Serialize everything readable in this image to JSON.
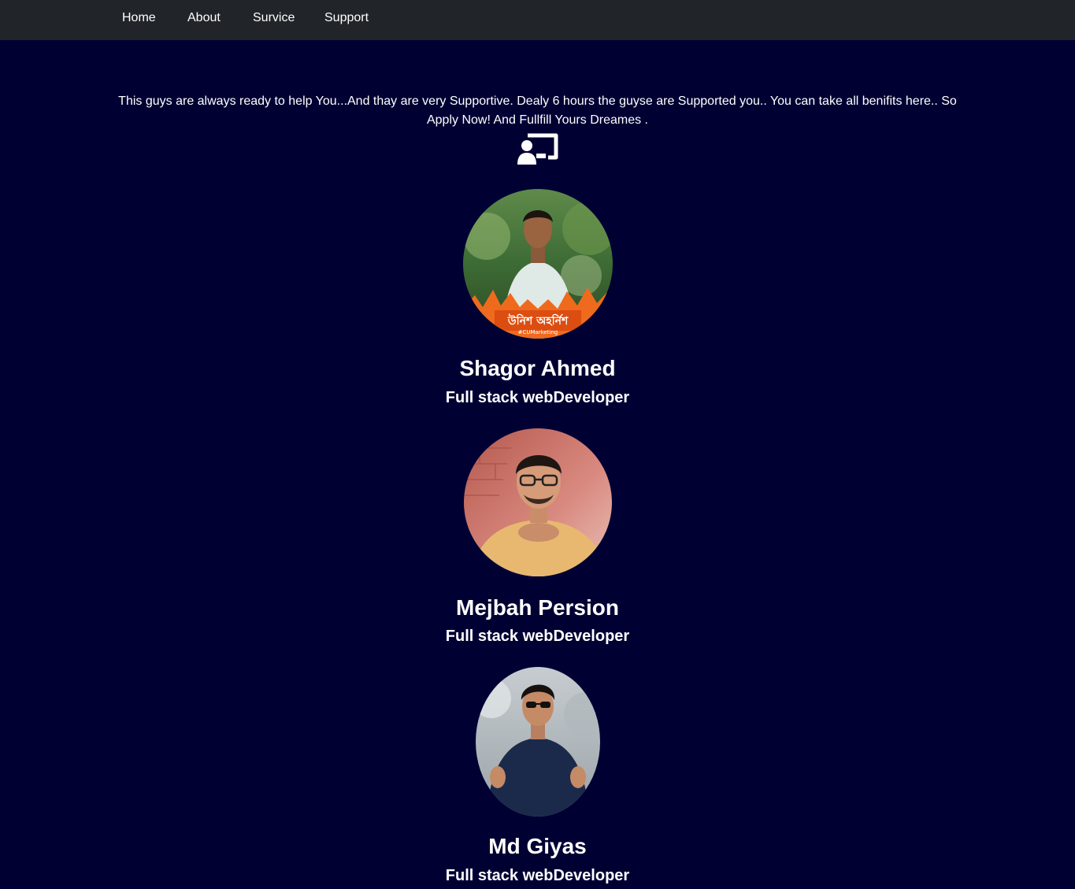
{
  "nav": {
    "items": [
      {
        "label": "Home"
      },
      {
        "label": "About"
      },
      {
        "label": "Survice"
      },
      {
        "label": "Support"
      }
    ]
  },
  "intro": {
    "text": "This guys are always ready to help You...And thay are very Supportive. Dealy 6 hours the guyse are Supported you.. You can take all benifits here.. So Apply Now! And Fullfill Yours Dreames ."
  },
  "header_icon": "chalkboard-user-icon",
  "team": [
    {
      "name": "Shagor Ahmed",
      "role": "Full stack webDeveloper",
      "photo_caption": "উনিশ অহর্নিশ",
      "photo_subcaption": "#CUMarketing"
    },
    {
      "name": "Mejbah Persion",
      "role": "Full stack webDeveloper"
    },
    {
      "name": "Md Giyas",
      "role": "Full stack webDeveloper"
    }
  ],
  "colors": {
    "page_background": "#000033",
    "navbar_background": "#212529",
    "text": "#ffffff"
  }
}
